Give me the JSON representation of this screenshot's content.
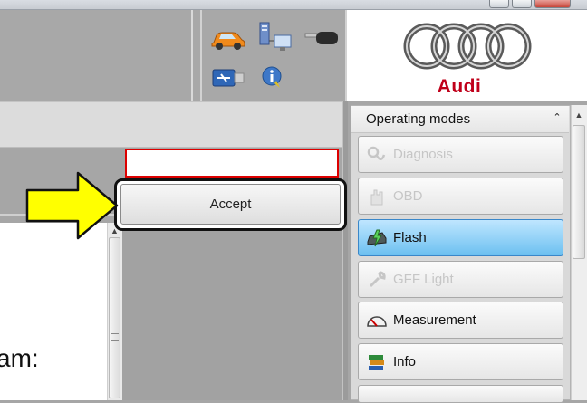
{
  "logo": {
    "brand": "Audi"
  },
  "dialog": {
    "accept_label": "Accept",
    "red_field_value": ""
  },
  "content": {
    "partial_text": "am:"
  },
  "modes_panel": {
    "title": "Operating modes",
    "collapse_glyph": "⌃",
    "items": [
      {
        "label": "Diagnosis",
        "state": "disabled",
        "icon": "stethoscope-icon"
      },
      {
        "label": "OBD",
        "state": "disabled",
        "icon": "hand-icon"
      },
      {
        "label": "Flash",
        "state": "active",
        "icon": "flash-car-icon"
      },
      {
        "label": "GFF Light",
        "state": "disabled",
        "icon": "wrench-icon"
      },
      {
        "label": "Measurement",
        "state": "enabled",
        "icon": "gauge-icon"
      },
      {
        "label": "Info",
        "state": "enabled",
        "icon": "books-icon"
      }
    ]
  },
  "toolbar_icons": [
    "car-icon",
    "network-icon",
    "key-icon",
    "usb-icon",
    "info-icon"
  ],
  "colors": {
    "active_mode": "#6cc0f0",
    "arrow": "#ffff00",
    "audi_red": "#c0001a",
    "field_border": "#dd0000"
  }
}
